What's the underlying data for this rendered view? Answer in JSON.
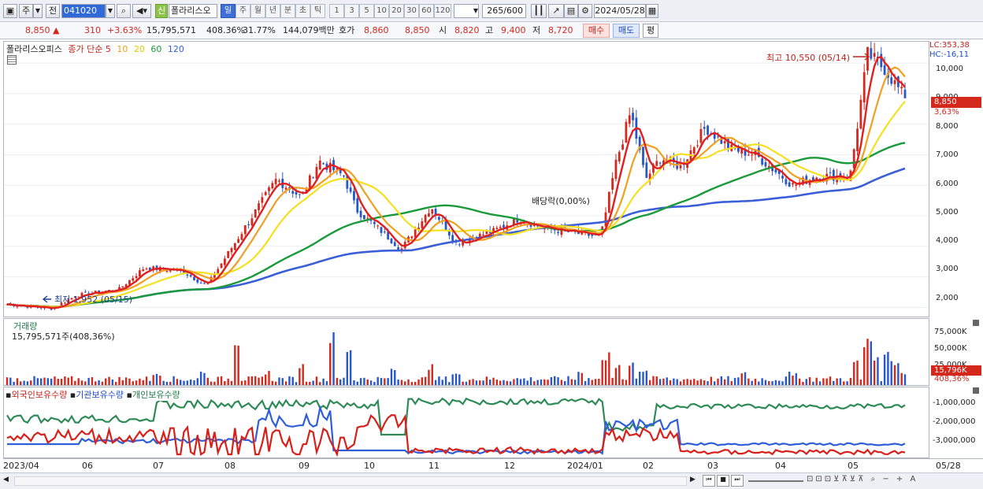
{
  "toolbar": {
    "market": "주",
    "prev_btn": "전",
    "code": "041020",
    "name": "폴라리스오",
    "new_badge": "신",
    "periods": [
      "일",
      "주",
      "월",
      "년",
      "분",
      "초",
      "틱"
    ],
    "active_period": "일",
    "minute_options": [
      "1",
      "3",
      "5",
      "10",
      "20",
      "30",
      "60",
      "120"
    ],
    "count": "265",
    "count_total": "/600",
    "date": "2024/05/28"
  },
  "quote": {
    "price": "8,850 ▲",
    "change": "310",
    "change_pct": "+3.63%",
    "volume": "15,795,571",
    "volume_pct": "408.36%",
    "turnover": "31.77%",
    "amount": "144,079백만",
    "hoga_label": "호가",
    "bid": "8,860",
    "ask": "8,850",
    "open_label": "시",
    "open": "8,820",
    "high_label": "고",
    "high": "9,400",
    "low_label": "저",
    "low": "8,720",
    "buy_btn": "매수",
    "sell_btn": "매도",
    "eval_btn": "평"
  },
  "main_panel": {
    "name": "폴라리스오피스",
    "indicator": "종가 단순",
    "ma": [
      "5",
      "10",
      "20",
      "60",
      "120"
    ],
    "ma_colors": [
      "#e02020",
      "#f0a020",
      "#f5e020",
      "#1a9a3a",
      "#3a5fd8"
    ],
    "lc": "LC:353,38",
    "hc": "HC:-16,11",
    "high_note": "최고 10,550 (05/14)",
    "low_note": "최저 1,952 (05/15)",
    "div_note": "배당락(0,00%)",
    "y_ticks": [
      "10,000",
      "9,000",
      "8,000",
      "7,000",
      "6,000",
      "5,000",
      "4,000",
      "3,000",
      "2,000"
    ],
    "price_tag": "8,850",
    "pct_tag": "3,63%"
  },
  "volume_panel": {
    "name": "거래량",
    "desc": "15,795,571주(408,36%)",
    "y_ticks": [
      "75,000K",
      "50,000K",
      "25,000K"
    ],
    "tag": "15,796K",
    "tag_pct": "408,36%"
  },
  "holding_panel": {
    "items": [
      "외국인보유수량",
      "기관보유수량",
      "개인보유수량"
    ],
    "colors": [
      "#d8201a",
      "#2f5fd8",
      "#2e8b57"
    ],
    "y_ticks": [
      "-1,000,000",
      "-2,000,000",
      "-3,000,000"
    ]
  },
  "x_axis": [
    "2023/04",
    "06",
    "07",
    "08",
    "09",
    "10",
    "11",
    "12",
    "2024/01",
    "02",
    "03",
    "04",
    "05",
    "05/28"
  ],
  "chart_data": {
    "type": "line",
    "title": "폴라리스오피스",
    "x": [
      "2023/04",
      "06",
      "07",
      "08",
      "09",
      "10",
      "11",
      "12",
      "2024/01",
      "02",
      "03",
      "04",
      "05",
      "05/28"
    ],
    "series": [
      {
        "name": "종가 (approx)",
        "values": [
          2100,
          2300,
          3200,
          4200,
          6500,
          4000,
          4300,
          4700,
          4600,
          6500,
          7300,
          6200,
          10300,
          8850
        ]
      },
      {
        "name": "120",
        "values": [
          1900,
          2050,
          2400,
          2800,
          3400,
          3800,
          4200,
          4500,
          4800,
          5200,
          5500,
          5900,
          6200,
          6600
        ]
      }
    ],
    "ylim": [
      1700,
      10700
    ]
  }
}
